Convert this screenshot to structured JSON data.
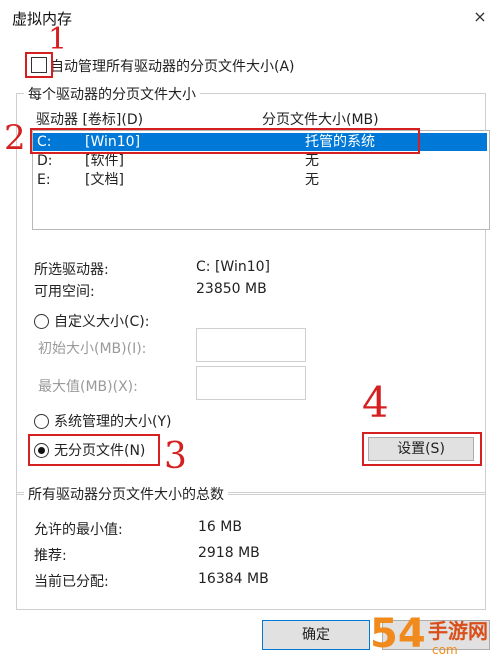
{
  "window": {
    "title": "虚拟内存",
    "close_icon": "×"
  },
  "auto_manage": {
    "label": "自动管理所有驱动器的分页文件大小(A)",
    "checked": false
  },
  "per_drive": {
    "title": "每个驱动器的分页文件大小",
    "col_drive": "驱动器 [卷标](D)",
    "col_size": "分页文件大小(MB)",
    "rows": [
      {
        "drive": "C:",
        "label": "[Win10]",
        "size": "托管的系统",
        "selected": true
      },
      {
        "drive": "D:",
        "label": "[软件]",
        "size": "无",
        "selected": false
      },
      {
        "drive": "E:",
        "label": "[文档]",
        "size": "无",
        "selected": false
      }
    ],
    "selected_drive_label": "所选驱动器:",
    "selected_drive_value": "C:  [Win10]",
    "free_space_label": "可用空间:",
    "free_space_value": "23850 MB",
    "custom_size_label": "自定义大小(C):",
    "initial_size_label": "初始大小(MB)(I):",
    "max_size_label": "最大值(MB)(X):",
    "system_managed_label": "系统管理的大小(Y)",
    "no_paging_label": "无分页文件(N)",
    "set_button": "设置(S)"
  },
  "totals": {
    "title": "所有驱动器分页文件大小的总数",
    "min_label": "允许的最小值:",
    "min_value": "16 MB",
    "recommended_label": "推荐:",
    "recommended_value": "2918 MB",
    "allocated_label": "当前已分配:",
    "allocated_value": "16384 MB"
  },
  "footer": {
    "ok_button": "确定"
  },
  "annotations": {
    "n1": "1",
    "n2": "2",
    "n3": "3",
    "n4": "4"
  },
  "watermark": {
    "number": "54",
    "text": "手游网",
    "domain": "com"
  },
  "colors": {
    "selection": "#0078d7",
    "annotation": "#d42020",
    "watermark": "#f08a1c"
  }
}
